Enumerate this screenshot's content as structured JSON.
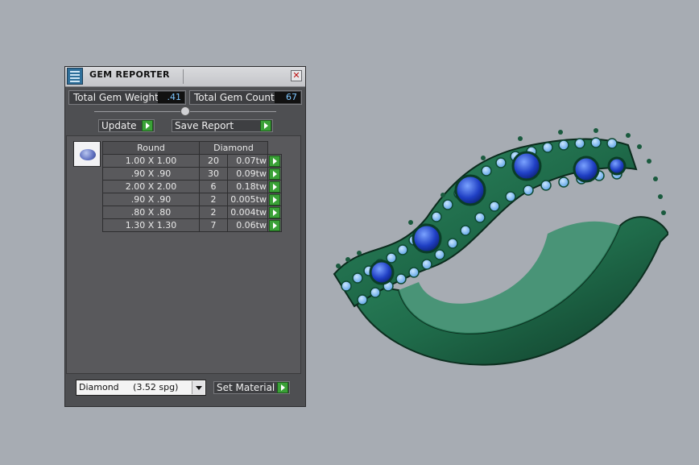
{
  "window": {
    "title": "GEM REPORTER",
    "close_symbol": "✕"
  },
  "stats": {
    "weight_label": "Total Gem Weight",
    "weight_value": ".41",
    "count_label": "Total Gem Count",
    "count_value": "67"
  },
  "buttons": {
    "update": "Update",
    "save_report": "Save Report",
    "set_material": "Set Material"
  },
  "table": {
    "header_shape": "Round",
    "header_material": "Diamond",
    "rows": [
      {
        "size": "1.00 X 1.00",
        "count": "20",
        "weight": "0.07tw"
      },
      {
        "size": ".90 X .90",
        "count": "30",
        "weight": "0.09tw"
      },
      {
        "size": "2.00 X 2.00",
        "count": "6",
        "weight": "0.18tw"
      },
      {
        "size": ".90 X .90",
        "count": "2",
        "weight": "0.005tw"
      },
      {
        "size": ".80 X .80",
        "count": "2",
        "weight": "0.004tw"
      },
      {
        "size": "1.30 X 1.30",
        "count": "7",
        "weight": "0.06tw"
      }
    ]
  },
  "material": {
    "selected": "Diamond     (3.52 spg)"
  },
  "colors": {
    "ring_metal": "#1f6b4a",
    "gem_blue": "#1f3fc4",
    "accent_green": "#3aa137",
    "value_text": "#7fc7ff"
  },
  "icons": {
    "app": "gem-reporter-icon",
    "gem_preview": "round-gem-icon",
    "go": "green-play-arrow-icon",
    "dropdown": "chevron-down-icon"
  }
}
